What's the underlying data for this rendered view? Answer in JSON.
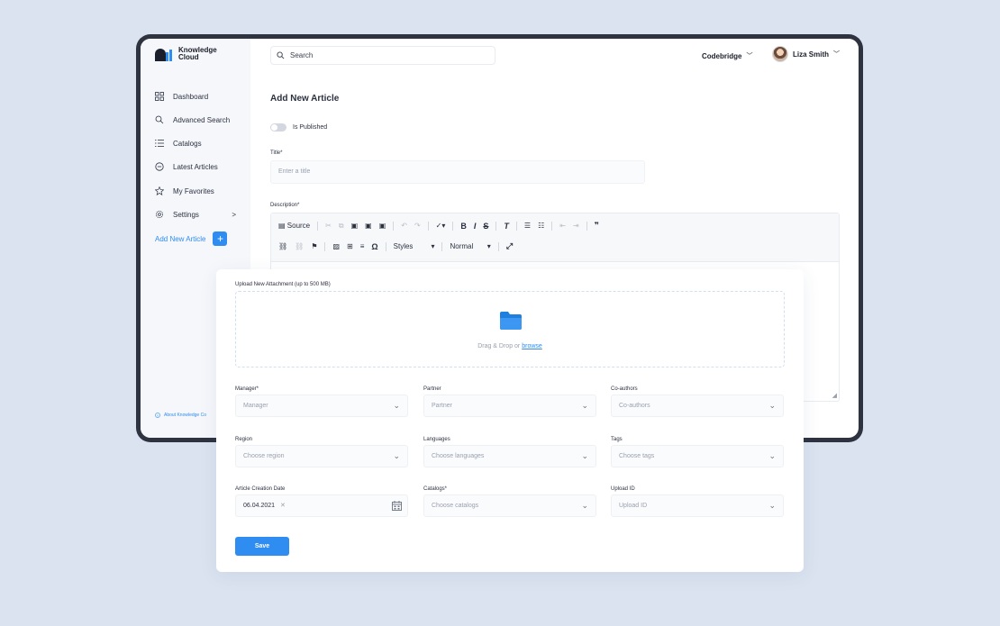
{
  "app": {
    "logo_line1": "Knowledge",
    "logo_line2": "Cloud"
  },
  "topbar": {
    "search_placeholder": "Search",
    "company": "Codebridge",
    "user_name": "Liza Smith"
  },
  "sidebar": {
    "items": [
      {
        "label": "Dashboard",
        "icon": "grid-icon"
      },
      {
        "label": "Advanced Search",
        "icon": "search-icon"
      },
      {
        "label": "Catalogs",
        "icon": "list-icon"
      },
      {
        "label": "Latest Articles",
        "icon": "minus-circle-icon"
      },
      {
        "label": "My Favorites",
        "icon": "star-icon"
      },
      {
        "label": "Settings",
        "icon": "gear-icon"
      }
    ],
    "settings_arrow": ">",
    "add_article": "Add New Article",
    "add_symbol": "+",
    "about": "About Knowledge Co"
  },
  "main": {
    "title": "Add New Article",
    "toggle_label": "Is Published",
    "title_label": "Title*",
    "title_placeholder": "Enter a title",
    "description_label": "Description*",
    "editor": {
      "source": "Source",
      "styles": "Styles",
      "format": "Normal"
    }
  },
  "form": {
    "upload_label": "Upload New Attachment (up to 500 MB)",
    "drop_text": "Drag & Drop or ",
    "browse": "browse",
    "fields": {
      "manager": {
        "label": "Manager*",
        "placeholder": "Manager"
      },
      "partner": {
        "label": "Partner",
        "placeholder": "Partner"
      },
      "coauthors": {
        "label": "Co-authors",
        "placeholder": "Co-authors"
      },
      "region": {
        "label": "Region",
        "placeholder": "Choose region"
      },
      "languages": {
        "label": "Languages",
        "placeholder": "Choose languages"
      },
      "tags": {
        "label": "Tags",
        "placeholder": "Choose tags"
      },
      "creation_date": {
        "label": "Article Creation Date",
        "value": "06.04.2021",
        "clear": "✕"
      },
      "catalogs": {
        "label": "Catalogs*",
        "placeholder": "Choose catalogs"
      },
      "upload_id": {
        "label": "Upload ID",
        "placeholder": "Upload ID"
      }
    },
    "save": "Save"
  },
  "colors": {
    "accent": "#2f8cf0",
    "background": "#dbe3f0",
    "frame": "#2f3340"
  }
}
